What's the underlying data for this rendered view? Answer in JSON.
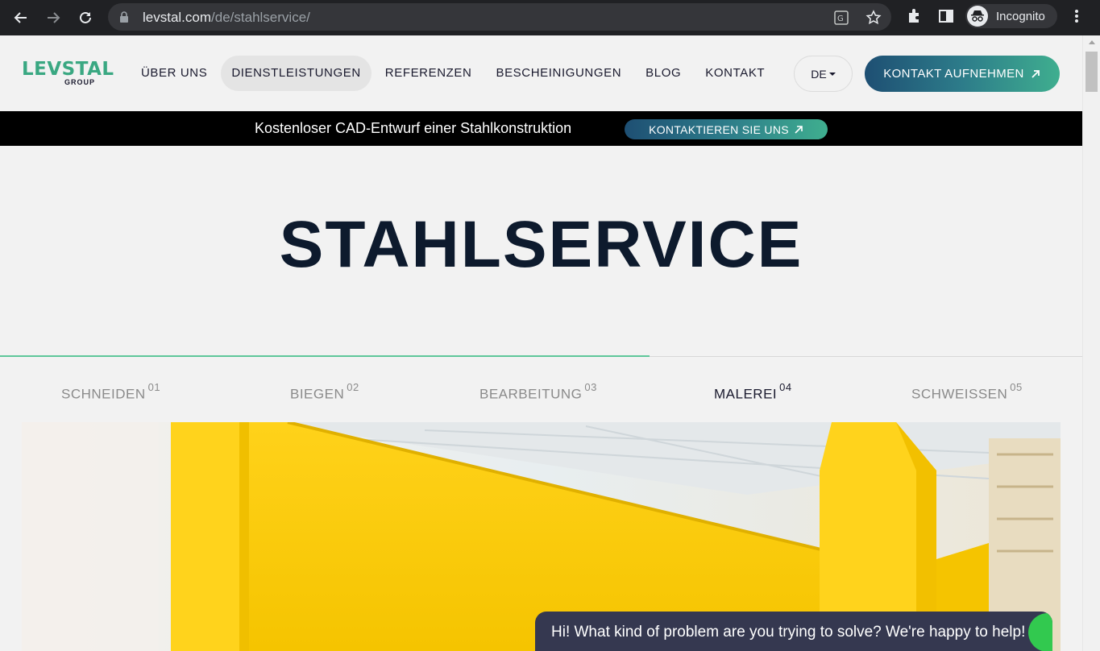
{
  "browser": {
    "url_domain": "levstal.com",
    "url_path": "/de/stahlservice/",
    "profile_label": "Incognito"
  },
  "header": {
    "logo_main": "LEVSTAL",
    "logo_sub": "GROUP",
    "menu": [
      {
        "label": "ÜBER UNS"
      },
      {
        "label": "DIENSTLEISTUNGEN"
      },
      {
        "label": "REFERENZEN"
      },
      {
        "label": "BESCHEINIGUNGEN"
      },
      {
        "label": "BLOG"
      },
      {
        "label": "KONTAKT"
      }
    ],
    "language": "DE",
    "cta_label": "KONTAKT AUFNEHMEN"
  },
  "banner": {
    "text": "Kostenloser CAD-Entwurf einer Stahlkonstruktion",
    "button_label": "KONTAKTIEREN SIE UNS"
  },
  "hero": {
    "title": "STAHLSERVICE"
  },
  "tabs": [
    {
      "label": "SCHNEIDEN",
      "num": "01"
    },
    {
      "label": "BIEGEN",
      "num": "02"
    },
    {
      "label": "BEARBEITUNG",
      "num": "03"
    },
    {
      "label": "MALEREI",
      "num": "04"
    },
    {
      "label": "SCHWEISSEN",
      "num": "05"
    }
  ],
  "tab_progress": 0.6,
  "colors": {
    "brand_green": "#3aa882",
    "gradient_start": "#1e4f73",
    "gradient_end": "#3fae8f",
    "chat_bg": "#353850"
  },
  "chat": {
    "message": "Hi! What kind of problem are you trying to solve? We're happy to help!"
  }
}
